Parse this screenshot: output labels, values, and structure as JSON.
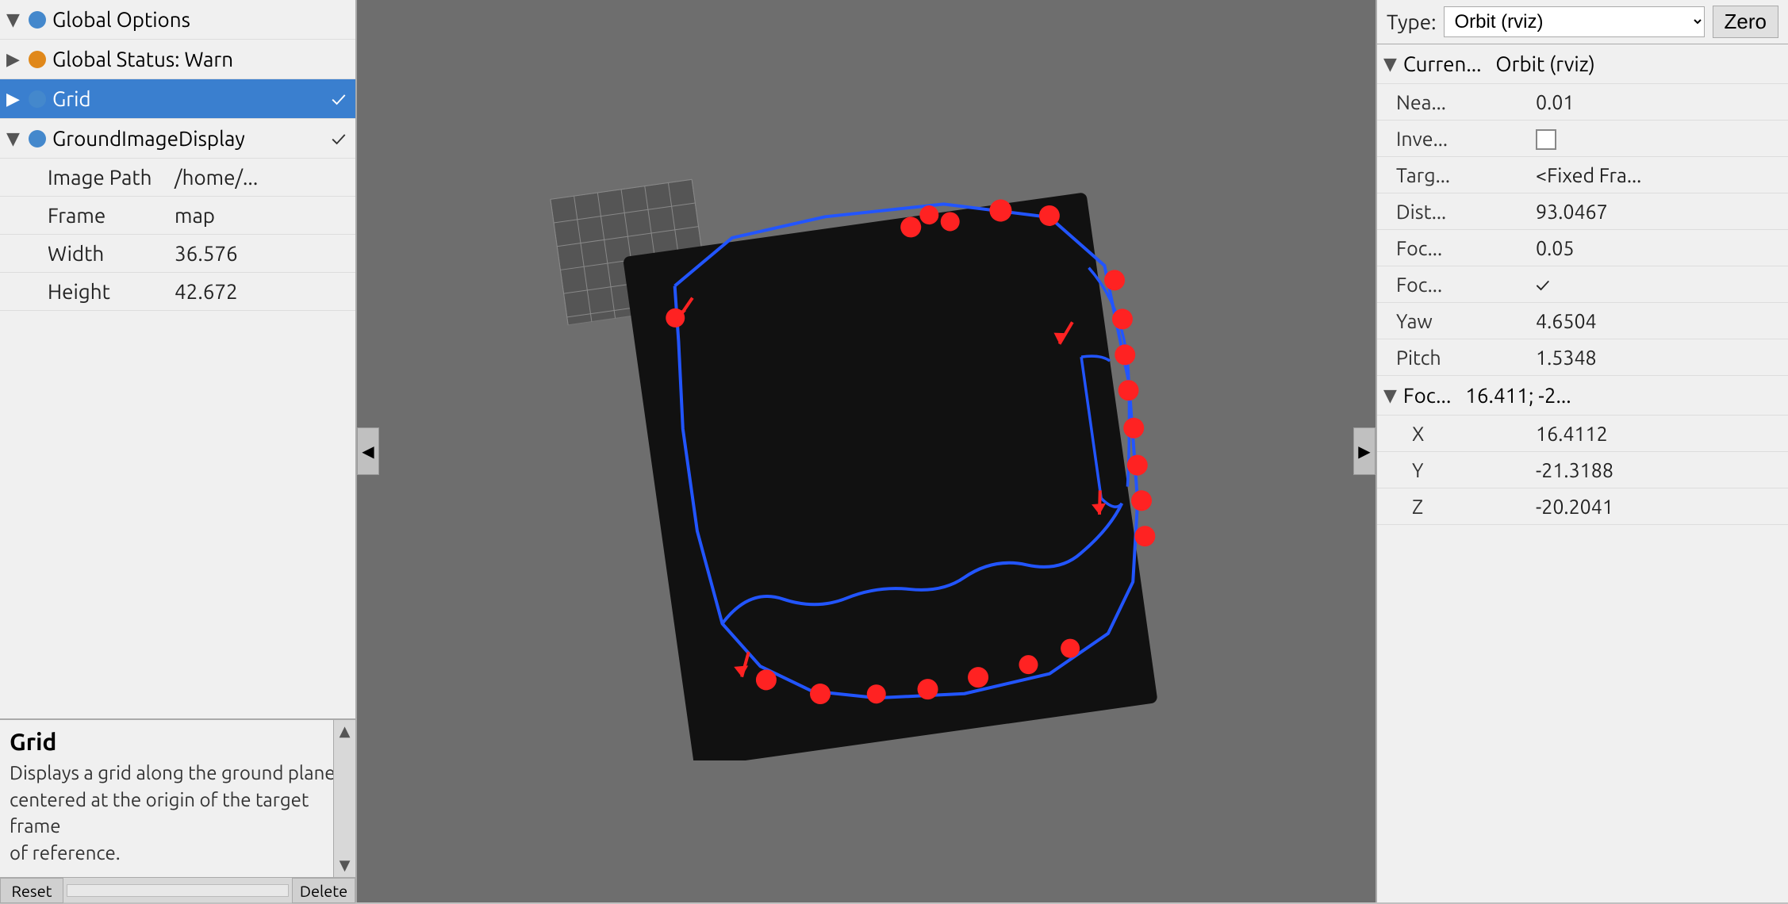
{
  "left_panel": {
    "tree": [
      {
        "id": "global-options",
        "label": "Global Options",
        "type": "header",
        "dot_color": "blue",
        "expanded": true,
        "selected": false,
        "has_check": false
      },
      {
        "id": "global-status",
        "label": "Global Status: Warn",
        "type": "status",
        "dot_color": "orange",
        "expanded": false,
        "selected": false,
        "has_check": false
      },
      {
        "id": "grid",
        "label": "Grid",
        "type": "item",
        "dot_color": "blue",
        "expanded": false,
        "selected": true,
        "has_check": true,
        "check_value": "✓"
      },
      {
        "id": "ground-image-display",
        "label": "GroundImageDisplay",
        "type": "item",
        "dot_color": "blue",
        "expanded": true,
        "selected": false,
        "has_check": true,
        "check_value": "✓"
      }
    ],
    "properties": [
      {
        "id": "image-path",
        "name": "Image Path",
        "value": "/home/..."
      },
      {
        "id": "frame",
        "name": "Frame",
        "value": "map"
      },
      {
        "id": "width",
        "name": "Width",
        "value": "36.576"
      },
      {
        "id": "height",
        "name": "Height",
        "value": "42.672"
      }
    ],
    "description": {
      "title": "Grid",
      "text": "Displays a grid along the ground plane,\ncentered at the origin of the target frame\nof reference."
    },
    "bottom_buttons": [
      "Reset",
      "Delete"
    ]
  },
  "viewport": {
    "collapse_arrow": "◀",
    "expand_arrow": "▶"
  },
  "right_panel": {
    "type_label": "Type:",
    "type_select": "Orbit (rviz",
    "zero_button": "Zero",
    "section_title_truncated": "Curren...",
    "section_title_full": "Orbit (rviz)",
    "properties": [
      {
        "id": "near-clip",
        "name": "Nea...",
        "value": "0.01"
      },
      {
        "id": "invert-zoom",
        "name": "Inve...",
        "value": "checkbox_empty"
      },
      {
        "id": "target-frame",
        "name": "Targ...",
        "value": "<Fixed Fra..."
      },
      {
        "id": "distance",
        "name": "Dist...",
        "value": "93.0467"
      },
      {
        "id": "focal-shape-size",
        "name": "Foc...",
        "value": "0.05"
      },
      {
        "id": "focal-shape-fixed-size",
        "name": "Foc...",
        "value": "✓"
      },
      {
        "id": "yaw",
        "name": "Yaw",
        "value": "4.6504"
      },
      {
        "id": "pitch",
        "name": "Pitch",
        "value": "1.5348"
      }
    ],
    "focal_point_section": {
      "title_truncated": "Foc...",
      "title_value": "16.411; -2...",
      "sub_properties": [
        {
          "id": "focus-x",
          "name": "X",
          "value": "16.4112"
        },
        {
          "id": "focus-y",
          "name": "Y",
          "value": "-21.3188"
        },
        {
          "id": "focus-z",
          "name": "Z",
          "value": "-20.2041"
        }
      ]
    }
  }
}
